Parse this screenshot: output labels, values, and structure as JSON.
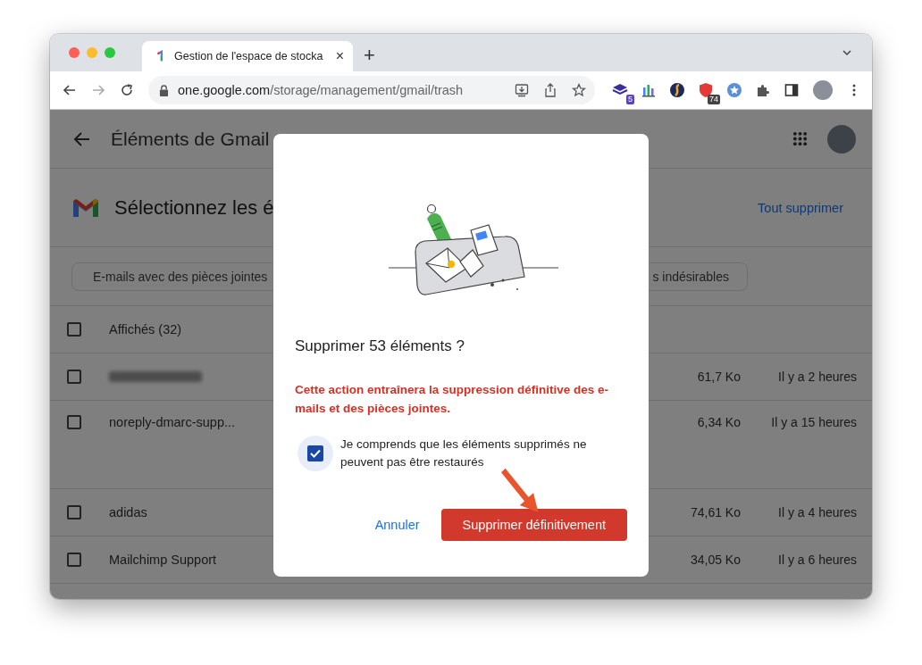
{
  "browser": {
    "tab": {
      "title": "Gestion de l'espace de stocka",
      "close": "×"
    },
    "new_tab": "+",
    "url": {
      "domain": "one.google.com",
      "path": "/storage/management/gmail/trash"
    },
    "extensions": [
      {
        "kind": "stack",
        "badge": "5"
      },
      {
        "kind": "bars"
      },
      {
        "kind": "swirl"
      },
      {
        "kind": "shield",
        "badge": "74"
      },
      {
        "kind": "star"
      }
    ]
  },
  "header": {
    "title": "Éléments de Gmail"
  },
  "section": {
    "title": "Sélectionnez les é",
    "action": "Tout supprimer"
  },
  "filters": [
    {
      "label": "E-mails avec des pièces jointes"
    },
    {
      "label": "s indésirables"
    }
  ],
  "list": {
    "header": {
      "label": "Affichés (32)",
      "checked": false
    },
    "rows": [
      {
        "blurred": true,
        "sender": "",
        "size": "61,7 Ko",
        "time": "Il y a 2 heures",
        "checked": false
      },
      {
        "blurred": false,
        "sender": "noreply-dmarc-supp...",
        "size": "6,34 Ko",
        "time": "Il y a 15 heures",
        "checked": false
      },
      {
        "blurred": false,
        "sender": "adidas",
        "size": "74,61 Ko",
        "time": "Il y a 4 heures",
        "checked": false
      },
      {
        "blurred": false,
        "sender": "Mailchimp Support",
        "size": "34,05 Ko",
        "time": "Il y a 6 heures",
        "checked": false
      }
    ]
  },
  "dialog": {
    "title": "Supprimer 53 éléments ?",
    "warning": "Cette action entraînera la suppression définitive des e-mails et des pièces jointes.",
    "confirm": {
      "label": "Je comprends que les éléments supprimés ne peuvent pas être restaurés",
      "checked": true
    },
    "buttons": [
      {
        "label": "Annuler",
        "kind": "text"
      },
      {
        "label": "Supprimer définitivement",
        "kind": "danger"
      }
    ]
  }
}
